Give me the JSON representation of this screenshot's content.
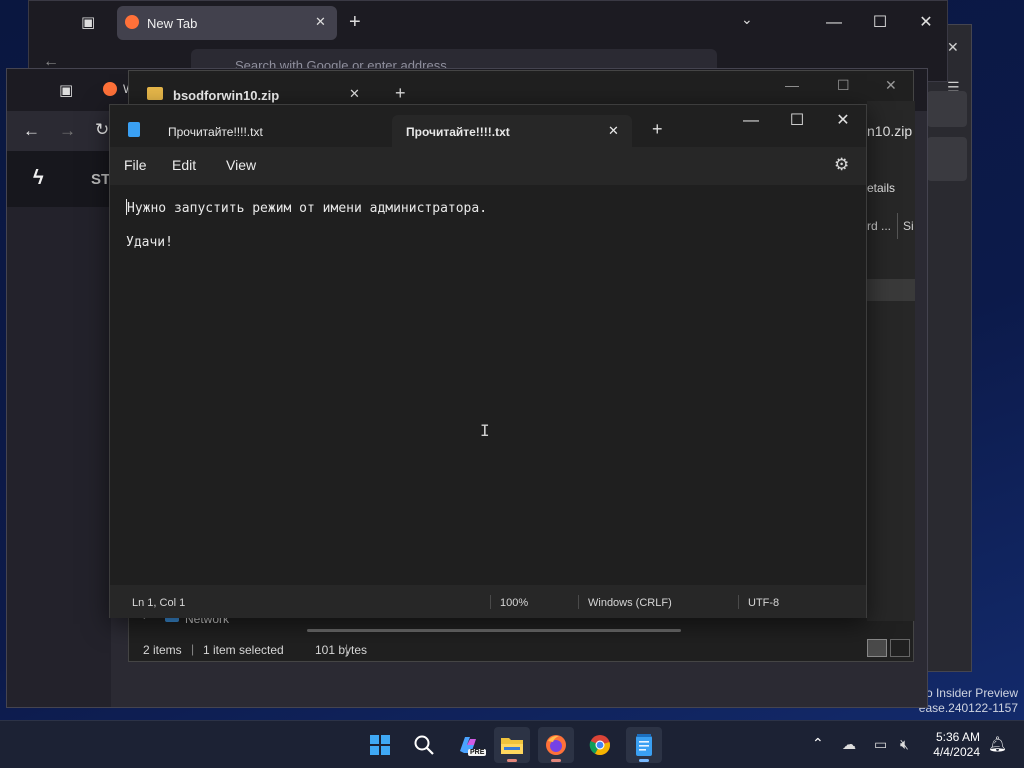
{
  "firefox_back": {
    "tab_title": "New Tab",
    "url_placeholder": "Search with Google or enter address"
  },
  "firefox_mid": {
    "tab_partial": "W",
    "page_partial": "ST"
  },
  "explorer": {
    "tab_title": "bsodforwin10.zip",
    "right_title_partial": "n10.zip",
    "details_label": "etails",
    "col_partial": "rd ...",
    "col_partial2": "Si",
    "nav_item": "Network",
    "status_items": "2 items",
    "status_selected": "1 item selected",
    "status_size": "101 bytes"
  },
  "notepad": {
    "tabs": [
      {
        "label": "Прочитайте!!!!.txt",
        "active": false
      },
      {
        "label": "Прочитайте!!!!.txt",
        "active": true
      }
    ],
    "menu": {
      "file": "File",
      "edit": "Edit",
      "view": "View"
    },
    "content": {
      "line1": "Нужно запустить режим от имени администратора.",
      "line3": "Удачи!"
    },
    "status": {
      "position": "Ln 1, Col 1",
      "zoom": "100%",
      "line_ending": "Windows (CRLF)",
      "encoding": "UTF-8"
    }
  },
  "watermark": {
    "line1": "ro Insider Preview",
    "line2": "ease.240122-1157"
  },
  "taskbar": {
    "apps": [
      "start-icon",
      "search-icon",
      "copilot-icon",
      "file-explorer-icon",
      "firefox-icon",
      "chrome-icon",
      "notepad-icon"
    ],
    "copilot_badge": "PRE",
    "time": "5:36 AM",
    "date": "4/4/2024"
  },
  "colors": {
    "accent_blue": "#0078d4",
    "firefox_orange": "#ff7139",
    "notepad_blue": "#3aa0f3"
  }
}
